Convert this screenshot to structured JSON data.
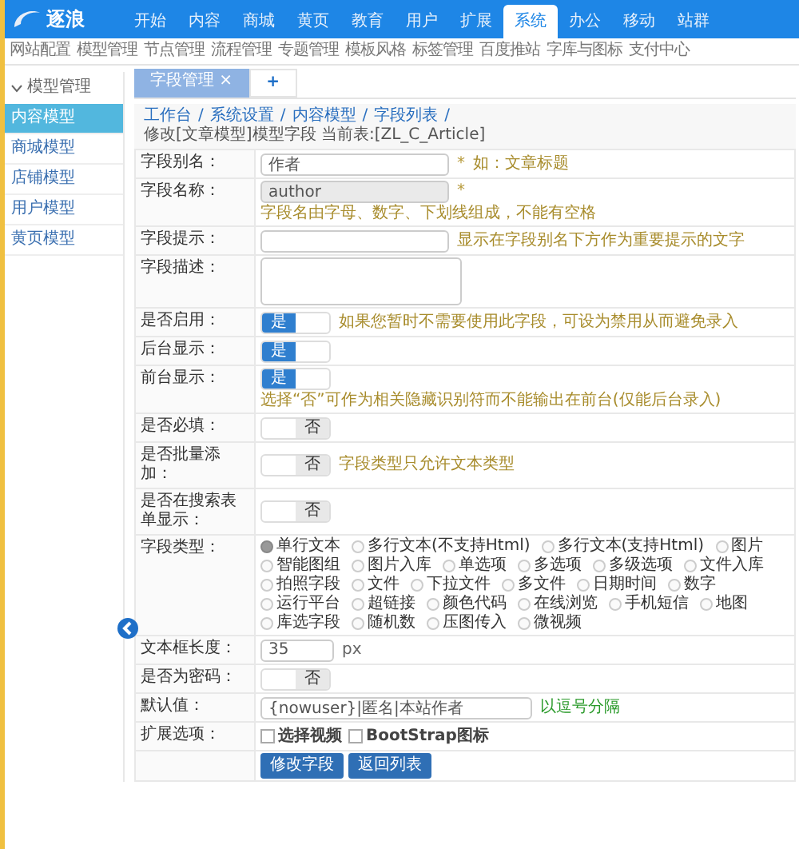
{
  "logo": {
    "text": "逐浪"
  },
  "nav": [
    {
      "label": "开始",
      "selected": false
    },
    {
      "label": "内容",
      "selected": false
    },
    {
      "label": "商城",
      "selected": false
    },
    {
      "label": "黄页",
      "selected": false
    },
    {
      "label": "教育",
      "selected": false
    },
    {
      "label": "用户",
      "selected": false
    },
    {
      "label": "扩展",
      "selected": false
    },
    {
      "label": "系统",
      "selected": true
    },
    {
      "label": "办公",
      "selected": false
    },
    {
      "label": "移动",
      "selected": false
    },
    {
      "label": "站群",
      "selected": false
    }
  ],
  "subnav": [
    "网站配置",
    "模型管理",
    "节点管理",
    "流程管理",
    "专题管理",
    "模板风格",
    "标签管理",
    "百度推站",
    "字库与图标",
    "支付中心"
  ],
  "sidebar": {
    "heading": "模型管理",
    "expanded": true,
    "items": [
      {
        "label": "内容模型",
        "selected": true
      },
      {
        "label": "商城模型",
        "selected": false
      },
      {
        "label": "店铺模型",
        "selected": false
      },
      {
        "label": "用户模型",
        "selected": false
      },
      {
        "label": "黄页模型",
        "selected": false
      }
    ]
  },
  "tabs": [
    {
      "label": "字段管理",
      "close": "×",
      "selected": true
    }
  ],
  "add_tab": "+",
  "breadcrumb": {
    "separator": "/",
    "items": [
      "工作台",
      "系统设置",
      "内容模型",
      "字段列表"
    ],
    "current": "修改[文章模型]模型字段 当前表:[ZL_C_Article]"
  },
  "rows": [
    {
      "label": "字段别名：",
      "kind": "text",
      "value": "作者",
      "disabled": false,
      "mark": "*",
      "hint": "如：文章标题"
    },
    {
      "label": "字段名称：",
      "kind": "text",
      "value": "author",
      "disabled": true,
      "mark": "*",
      "hint": "字段名由字母、数字、下划线组成，不能有空格"
    },
    {
      "label": "字段提示：",
      "kind": "text",
      "disabled": false,
      "hint": "显示在字段别名下方作为重要提示的文字"
    },
    {
      "label": "字段描述：",
      "kind": "textarea"
    },
    {
      "label": "是否启用：",
      "kind": "toggle",
      "on": true,
      "text": "是",
      "hint": "如果您暂时不需要使用此字段，可设为禁用从而避免录入"
    },
    {
      "label": "后台显示：",
      "kind": "toggle",
      "on": true,
      "text": "是"
    },
    {
      "label": "前台显示：",
      "kind": "toggle",
      "on": true,
      "text": "是",
      "hint": "选择“否”可作为相关隐藏识别符而不能输出在前台(仅能后台录入)"
    },
    {
      "label": "是否必填：",
      "kind": "toggle",
      "on": false,
      "text": "否"
    },
    {
      "label": "是否批量添加：",
      "kind": "toggle",
      "on": false,
      "text": "否",
      "hint": "字段类型只允许文本类型"
    },
    {
      "label": "是否在搜索表单显示：",
      "kind": "toggle",
      "on": false,
      "text": "否"
    },
    {
      "label": "字段类型：",
      "kind": "radios",
      "options": [
        {
          "label": "单行文本",
          "selected": true
        },
        {
          "label": "多行文本(不支持Html)",
          "selected": false
        },
        {
          "label": "多行文本(支持Html)",
          "selected": false
        },
        {
          "label": "图片",
          "selected": false
        },
        {
          "label": "智能图组",
          "selected": false
        },
        {
          "label": "图片入库",
          "selected": false
        },
        {
          "label": "单选项",
          "selected": false
        },
        {
          "label": "多选项",
          "selected": false
        },
        {
          "label": "多级选项",
          "selected": false
        },
        {
          "label": "文件入库",
          "selected": false
        },
        {
          "label": "拍照字段",
          "selected": false
        },
        {
          "label": "文件",
          "selected": false
        },
        {
          "label": "下拉文件",
          "selected": false
        },
        {
          "label": "多文件",
          "selected": false
        },
        {
          "label": "日期时间",
          "selected": false
        },
        {
          "label": "数字",
          "selected": false
        },
        {
          "label": "运行平台",
          "selected": false
        },
        {
          "label": "超链接",
          "selected": false
        },
        {
          "label": "颜色代码",
          "selected": false
        },
        {
          "label": "在线浏览",
          "selected": false
        },
        {
          "label": "手机短信",
          "selected": false
        },
        {
          "label": "地图",
          "selected": false
        },
        {
          "label": "库选字段",
          "selected": false
        },
        {
          "label": "随机数",
          "selected": false
        },
        {
          "label": "压图传入",
          "selected": false
        },
        {
          "label": "微视频",
          "selected": false
        }
      ]
    },
    {
      "label": "文本框长度：",
      "kind": "number",
      "value": "35",
      "unit": "px"
    },
    {
      "label": "是否为密码：",
      "kind": "toggle",
      "on": false,
      "text": "否"
    },
    {
      "label": "默认值：",
      "kind": "text",
      "wide": true,
      "disabled": false,
      "value": "{nowuser}|匿名|本站作者",
      "hint": "以逗号分隔",
      "hint_success": true
    },
    {
      "label": "扩展选项：",
      "kind": "checks",
      "options": [
        {
          "label": "选择视频",
          "checked": false
        },
        {
          "label": "BootStrap图标",
          "checked": false
        }
      ]
    },
    {
      "kind": "buttons",
      "buttons": [
        "修改字段",
        "返回列表"
      ]
    }
  ]
}
